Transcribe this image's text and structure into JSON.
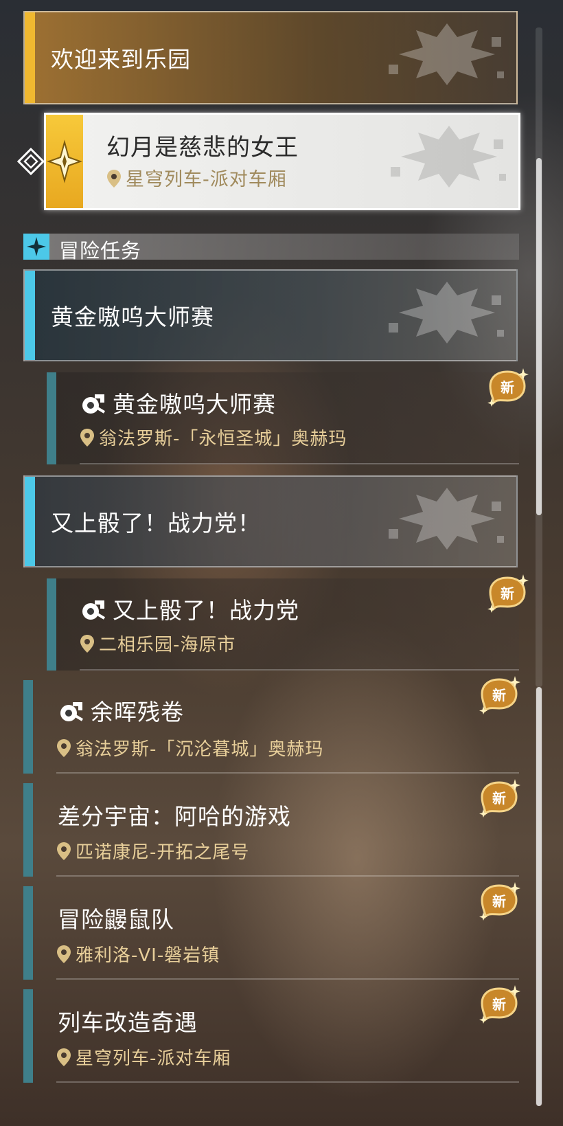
{
  "header": {
    "welcome_title": "欢迎来到乐园"
  },
  "active_quest": {
    "name": "幻月是慈悲的女王",
    "location": "星穹列车-派对车厢"
  },
  "section": {
    "label": "冒险任务"
  },
  "groups": [
    {
      "title": "黄金嗷呜大师赛",
      "quest": {
        "name": "黄金嗷呜大师赛",
        "location": "翁法罗斯-「永恒圣城」奥赫玛",
        "badge": "新"
      }
    },
    {
      "title": "又上骰了！战力党！",
      "quest": {
        "name": "又上骰了！战力党",
        "location": "二相乐园-海原市",
        "badge": "新"
      }
    }
  ],
  "quests": [
    {
      "name": "余晖残卷",
      "location": "翁法罗斯-「沉沦暮城」奥赫玛",
      "badge": "新",
      "has_icon": true
    },
    {
      "name": "差分宇宙：阿哈的游戏",
      "location": "匹诺康尼-开拓之尾号",
      "badge": "新",
      "has_icon": false
    },
    {
      "name": "冒险鼹鼠队",
      "location": "雅利洛-VI-磐岩镇",
      "badge": "新",
      "has_icon": false
    },
    {
      "name": "列车改造奇遇",
      "location": "星穹列车-派对车厢",
      "badge": "新",
      "has_icon": false
    }
  ],
  "colors": {
    "gold_accent": "#f0b830",
    "cyan_accent": "#4cc8e8",
    "teal_bar": "#3f7f8a",
    "location_text": "#e8cf9a",
    "badge_fill": "#c8872a"
  },
  "icons": {
    "pin": "map-pin-icon",
    "quest": "adventure-quest-icon",
    "section": "four-point-star-icon",
    "selected": "selector-diamond-icon",
    "active": "trailblaze-quest-emblem-icon"
  }
}
